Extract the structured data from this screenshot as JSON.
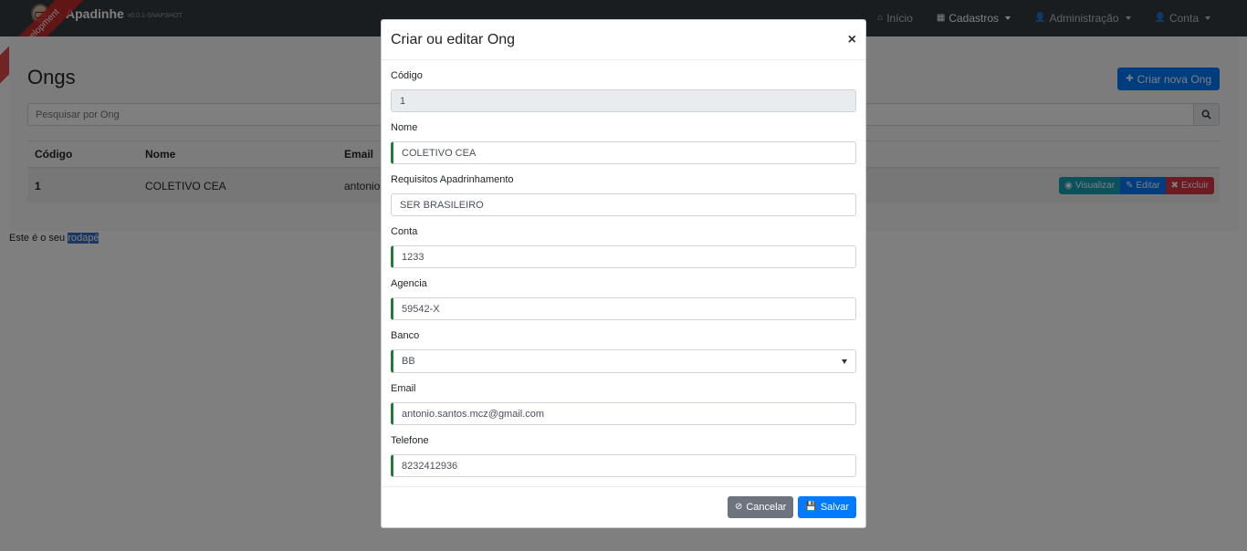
{
  "app": {
    "name": "Apadinhe",
    "version": "v0.0.1-SNAPSHOT",
    "ribbon": "Development"
  },
  "nav": {
    "home": "Início",
    "registrations": "Cadastros",
    "administration": "Administração",
    "account": "Conta"
  },
  "page": {
    "title": "Ongs",
    "create_button": "Criar nova Ong",
    "search_placeholder": "Pesquisar por Ong",
    "table": {
      "headers": [
        "Código",
        "Nome",
        "Email"
      ],
      "rows": [
        {
          "code": "1",
          "name": "COLETIVO CEA",
          "email": "antonio.s"
        }
      ]
    },
    "row_actions": {
      "view": "Visualizar",
      "edit": "Editar",
      "delete": "Excluir"
    },
    "footer": {
      "text": "Este é o seu ",
      "link": "rodapé"
    }
  },
  "modal": {
    "title": "Criar ou editar Ong",
    "close": "×",
    "fields": {
      "code": {
        "label": "Código",
        "value": "1"
      },
      "name": {
        "label": "Nome",
        "value": "COLETIVO CEA"
      },
      "requirements": {
        "label": "Requisitos Apadrinhamento",
        "value": "SER BRASILEIRO"
      },
      "account": {
        "label": "Conta",
        "value": "1233"
      },
      "agency": {
        "label": "Agencia",
        "value": "59542-X"
      },
      "bank": {
        "label": "Banco",
        "value": "BB"
      },
      "email": {
        "label": "Email",
        "value": "antonio.santos.mcz@gmail.com"
      },
      "phone": {
        "label": "Telefone",
        "value": "8232412936"
      }
    },
    "cancel": "Cancelar",
    "save": "Salvar"
  },
  "colors": {
    "primary": "#007bff",
    "secondary": "#6c757d",
    "info": "#17a2b8",
    "danger": "#dc3545",
    "valid": "#1e7e34",
    "navbar": "#353a40"
  }
}
